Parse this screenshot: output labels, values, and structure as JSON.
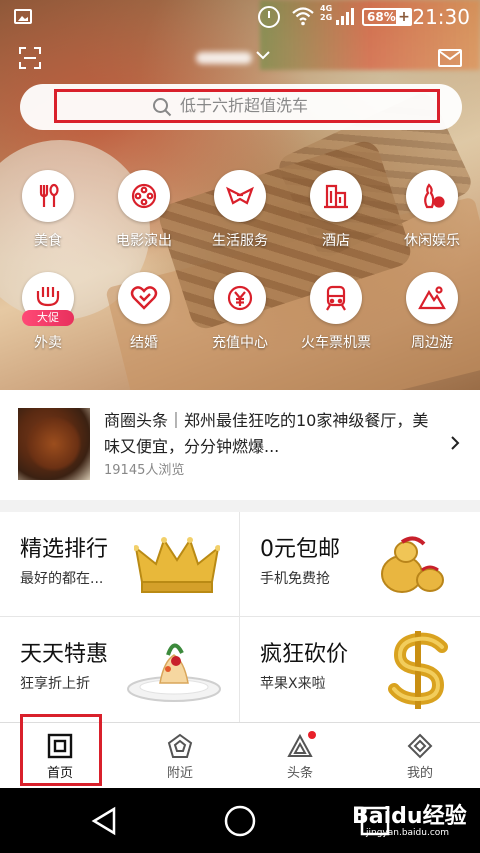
{
  "status_bar": {
    "network_label": "4G\n2G",
    "battery": "68%",
    "time": "21:30"
  },
  "header": {
    "city_label": ""
  },
  "search": {
    "placeholder": "低于六折超值洗车"
  },
  "categories": [
    {
      "label": "美食",
      "icon": "fork-spoon-icon"
    },
    {
      "label": "电影演出",
      "icon": "film-reel-icon"
    },
    {
      "label": "生活服务",
      "icon": "bowtie-icon"
    },
    {
      "label": "酒店",
      "icon": "hotel-building-icon"
    },
    {
      "label": "休闲娱乐",
      "icon": "bowling-icon"
    },
    {
      "label": "外卖",
      "icon": "takeout-icon",
      "badge": "大促"
    },
    {
      "label": "结婚",
      "icon": "heart-icon"
    },
    {
      "label": "充值中心",
      "icon": "yuan-coin-icon"
    },
    {
      "label": "火车票机票",
      "icon": "train-icon"
    },
    {
      "label": "周边游",
      "icon": "mountain-icon"
    }
  ],
  "headline": {
    "title": "商圈头条｜郑州最佳狂吃的10家神级餐厅，美味又便宜，分分钟燃爆...",
    "views": "19145人浏览"
  },
  "promos": [
    {
      "title": "精选排行",
      "subtitle": "最好的都在..."
    },
    {
      "title": "0元包邮",
      "subtitle": "手机免费抢"
    },
    {
      "title": "天天特惠",
      "subtitle": "狂享折上折"
    },
    {
      "title": "疯狂砍价",
      "subtitle": "苹果X来啦"
    }
  ],
  "tabs": [
    {
      "label": "首页",
      "icon": "home-square-icon"
    },
    {
      "label": "附近",
      "icon": "pentagon-icon"
    },
    {
      "label": "头条",
      "icon": "triangle-icon"
    },
    {
      "label": "我的",
      "icon": "diamond-icon"
    }
  ],
  "watermark": {
    "brand": "Baidu经验",
    "url": "jingyan.baidu.com"
  },
  "colors": {
    "highlight_red": "#d9202b",
    "badge_pink": "#ff4a76"
  }
}
